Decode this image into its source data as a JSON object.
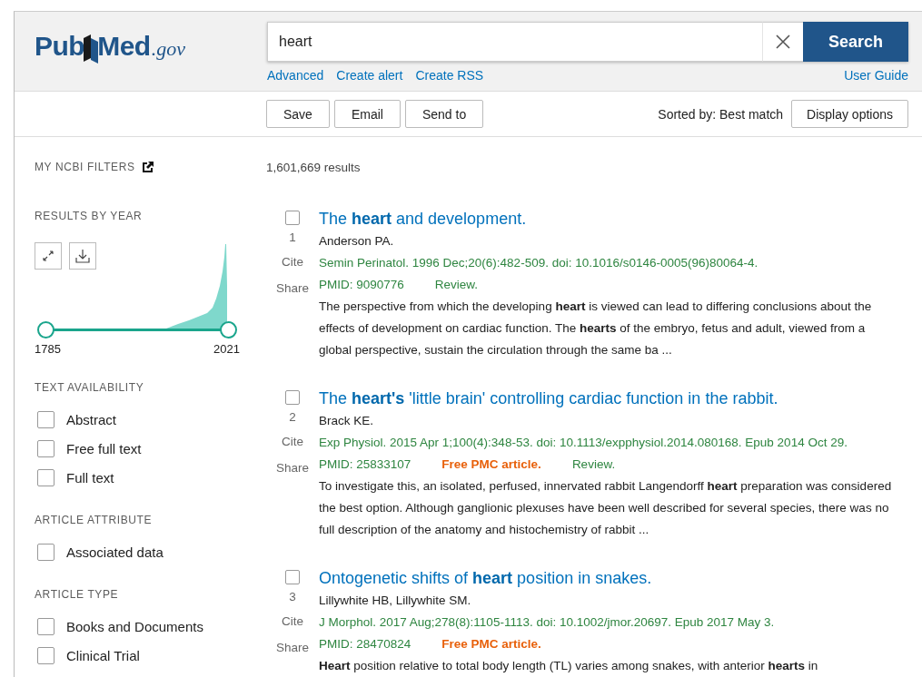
{
  "logo": {
    "left": "Pub",
    "right": "Med",
    "suffix": ".gov"
  },
  "search": {
    "value": "heart",
    "button": "Search",
    "links": [
      "Advanced",
      "Create alert",
      "Create RSS"
    ],
    "guide": "User Guide"
  },
  "toolbar": {
    "buttons": [
      "Save",
      "Email",
      "Send to"
    ],
    "sort": "Sorted by: Best match",
    "display": "Display options"
  },
  "sidebar": {
    "filters_title": "MY NCBI FILTERS",
    "year_title": "RESULTS BY YEAR",
    "thumbs": [
      {
        "label": "1785",
        "level": 0
      },
      {
        "label": "2021",
        "level": 1
      }
    ],
    "groups": [
      {
        "title": "TEXT AVAILABILITY",
        "items": [
          {
            "label": "Abstract",
            "checked": false
          },
          {
            "label": "Free full text",
            "checked": false
          },
          {
            "label": "Full text",
            "checked": false
          }
        ]
      },
      {
        "title": "ARTICLE ATTRIBUTE",
        "items": [
          {
            "label": "Associated data",
            "checked": false
          }
        ]
      },
      {
        "title": "ARTICLE TYPE",
        "items": [
          {
            "label": "Books and Documents",
            "checked": false
          },
          {
            "label": "Clinical Trial",
            "checked": false
          }
        ]
      }
    ]
  },
  "count": "1,601,669 results",
  "results": [
    {
      "checked": false,
      "number": "1",
      "cite": "Cite",
      "share": "Share",
      "title": "The **heart** and development.",
      "authors": "Anderson PA.",
      "citation": "Semin Perinatol. 1996 Dec;20(6):482-509. doi: 10.1016/s0146-0005(96)80064-4.",
      "pmid": "PMID: 9090776",
      "tags": [
        {
          "kind": "review",
          "label": "Review."
        }
      ],
      "snippet": "The perspective from which the developing **heart** is viewed can lead to differing conclusions about the effects of development on cardiac function. The **hearts** of the embryo, fetus and adult, viewed from a global perspective, sustain the circulation through the same ba ..."
    },
    {
      "checked": false,
      "number": "2",
      "cite": "Cite",
      "share": "Share",
      "title": "The **heart's** 'little brain' controlling cardiac function in the rabbit.",
      "authors": "Brack KE.",
      "citation": "Exp Physiol. 2015 Apr 1;100(4):348-53. doi: 10.1113/expphysiol.2014.080168. Epub 2014 Oct 29.",
      "pmid": "PMID: 25833107",
      "tags": [
        {
          "kind": "free",
          "label": "Free PMC article."
        },
        {
          "kind": "review",
          "label": "Review."
        }
      ],
      "snippet": "To investigate this, an isolated, perfused, innervated rabbit Langendorff **heart** preparation was considered the best option. Although ganglionic plexuses have been well described for several species, there was no full description of the anatomy and histochemistry of rabbit ..."
    },
    {
      "checked": false,
      "number": "3",
      "cite": "Cite",
      "share": "Share",
      "title": "Ontogenetic shifts of **heart** position in snakes.",
      "authors": "Lillywhite HB, Lillywhite SM.",
      "citation": "J Morphol. 2017 Aug;278(8):1105-1113. doi: 10.1002/jmor.20697. Epub 2017 May 3.",
      "pmid": "PMID: 28470824",
      "tags": [
        {
          "kind": "free",
          "label": "Free PMC article."
        }
      ],
      "snippet": "**Heart** position relative to total body length (TL) varies among snakes, with anterior **hearts** in"
    }
  ]
}
